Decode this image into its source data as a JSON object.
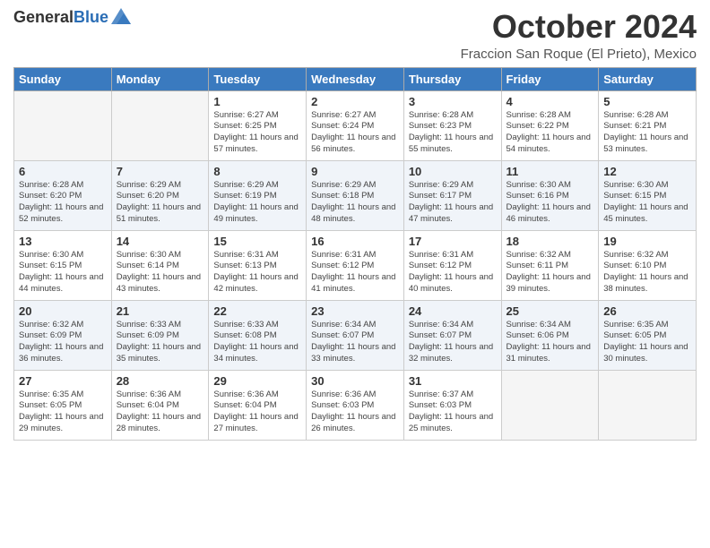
{
  "header": {
    "logo_general": "General",
    "logo_blue": "Blue",
    "month": "October 2024",
    "location": "Fraccion San Roque (El Prieto), Mexico"
  },
  "weekdays": [
    "Sunday",
    "Monday",
    "Tuesday",
    "Wednesday",
    "Thursday",
    "Friday",
    "Saturday"
  ],
  "weeks": [
    [
      {
        "day": "",
        "sunrise": "",
        "sunset": "",
        "daylight": ""
      },
      {
        "day": "",
        "sunrise": "",
        "sunset": "",
        "daylight": ""
      },
      {
        "day": "1",
        "sunrise": "Sunrise: 6:27 AM",
        "sunset": "Sunset: 6:25 PM",
        "daylight": "Daylight: 11 hours and 57 minutes."
      },
      {
        "day": "2",
        "sunrise": "Sunrise: 6:27 AM",
        "sunset": "Sunset: 6:24 PM",
        "daylight": "Daylight: 11 hours and 56 minutes."
      },
      {
        "day": "3",
        "sunrise": "Sunrise: 6:28 AM",
        "sunset": "Sunset: 6:23 PM",
        "daylight": "Daylight: 11 hours and 55 minutes."
      },
      {
        "day": "4",
        "sunrise": "Sunrise: 6:28 AM",
        "sunset": "Sunset: 6:22 PM",
        "daylight": "Daylight: 11 hours and 54 minutes."
      },
      {
        "day": "5",
        "sunrise": "Sunrise: 6:28 AM",
        "sunset": "Sunset: 6:21 PM",
        "daylight": "Daylight: 11 hours and 53 minutes."
      }
    ],
    [
      {
        "day": "6",
        "sunrise": "Sunrise: 6:28 AM",
        "sunset": "Sunset: 6:20 PM",
        "daylight": "Daylight: 11 hours and 52 minutes."
      },
      {
        "day": "7",
        "sunrise": "Sunrise: 6:29 AM",
        "sunset": "Sunset: 6:20 PM",
        "daylight": "Daylight: 11 hours and 51 minutes."
      },
      {
        "day": "8",
        "sunrise": "Sunrise: 6:29 AM",
        "sunset": "Sunset: 6:19 PM",
        "daylight": "Daylight: 11 hours and 49 minutes."
      },
      {
        "day": "9",
        "sunrise": "Sunrise: 6:29 AM",
        "sunset": "Sunset: 6:18 PM",
        "daylight": "Daylight: 11 hours and 48 minutes."
      },
      {
        "day": "10",
        "sunrise": "Sunrise: 6:29 AM",
        "sunset": "Sunset: 6:17 PM",
        "daylight": "Daylight: 11 hours and 47 minutes."
      },
      {
        "day": "11",
        "sunrise": "Sunrise: 6:30 AM",
        "sunset": "Sunset: 6:16 PM",
        "daylight": "Daylight: 11 hours and 46 minutes."
      },
      {
        "day": "12",
        "sunrise": "Sunrise: 6:30 AM",
        "sunset": "Sunset: 6:15 PM",
        "daylight": "Daylight: 11 hours and 45 minutes."
      }
    ],
    [
      {
        "day": "13",
        "sunrise": "Sunrise: 6:30 AM",
        "sunset": "Sunset: 6:15 PM",
        "daylight": "Daylight: 11 hours and 44 minutes."
      },
      {
        "day": "14",
        "sunrise": "Sunrise: 6:30 AM",
        "sunset": "Sunset: 6:14 PM",
        "daylight": "Daylight: 11 hours and 43 minutes."
      },
      {
        "day": "15",
        "sunrise": "Sunrise: 6:31 AM",
        "sunset": "Sunset: 6:13 PM",
        "daylight": "Daylight: 11 hours and 42 minutes."
      },
      {
        "day": "16",
        "sunrise": "Sunrise: 6:31 AM",
        "sunset": "Sunset: 6:12 PM",
        "daylight": "Daylight: 11 hours and 41 minutes."
      },
      {
        "day": "17",
        "sunrise": "Sunrise: 6:31 AM",
        "sunset": "Sunset: 6:12 PM",
        "daylight": "Daylight: 11 hours and 40 minutes."
      },
      {
        "day": "18",
        "sunrise": "Sunrise: 6:32 AM",
        "sunset": "Sunset: 6:11 PM",
        "daylight": "Daylight: 11 hours and 39 minutes."
      },
      {
        "day": "19",
        "sunrise": "Sunrise: 6:32 AM",
        "sunset": "Sunset: 6:10 PM",
        "daylight": "Daylight: 11 hours and 38 minutes."
      }
    ],
    [
      {
        "day": "20",
        "sunrise": "Sunrise: 6:32 AM",
        "sunset": "Sunset: 6:09 PM",
        "daylight": "Daylight: 11 hours and 36 minutes."
      },
      {
        "day": "21",
        "sunrise": "Sunrise: 6:33 AM",
        "sunset": "Sunset: 6:09 PM",
        "daylight": "Daylight: 11 hours and 35 minutes."
      },
      {
        "day": "22",
        "sunrise": "Sunrise: 6:33 AM",
        "sunset": "Sunset: 6:08 PM",
        "daylight": "Daylight: 11 hours and 34 minutes."
      },
      {
        "day": "23",
        "sunrise": "Sunrise: 6:34 AM",
        "sunset": "Sunset: 6:07 PM",
        "daylight": "Daylight: 11 hours and 33 minutes."
      },
      {
        "day": "24",
        "sunrise": "Sunrise: 6:34 AM",
        "sunset": "Sunset: 6:07 PM",
        "daylight": "Daylight: 11 hours and 32 minutes."
      },
      {
        "day": "25",
        "sunrise": "Sunrise: 6:34 AM",
        "sunset": "Sunset: 6:06 PM",
        "daylight": "Daylight: 11 hours and 31 minutes."
      },
      {
        "day": "26",
        "sunrise": "Sunrise: 6:35 AM",
        "sunset": "Sunset: 6:05 PM",
        "daylight": "Daylight: 11 hours and 30 minutes."
      }
    ],
    [
      {
        "day": "27",
        "sunrise": "Sunrise: 6:35 AM",
        "sunset": "Sunset: 6:05 PM",
        "daylight": "Daylight: 11 hours and 29 minutes."
      },
      {
        "day": "28",
        "sunrise": "Sunrise: 6:36 AM",
        "sunset": "Sunset: 6:04 PM",
        "daylight": "Daylight: 11 hours and 28 minutes."
      },
      {
        "day": "29",
        "sunrise": "Sunrise: 6:36 AM",
        "sunset": "Sunset: 6:04 PM",
        "daylight": "Daylight: 11 hours and 27 minutes."
      },
      {
        "day": "30",
        "sunrise": "Sunrise: 6:36 AM",
        "sunset": "Sunset: 6:03 PM",
        "daylight": "Daylight: 11 hours and 26 minutes."
      },
      {
        "day": "31",
        "sunrise": "Sunrise: 6:37 AM",
        "sunset": "Sunset: 6:03 PM",
        "daylight": "Daylight: 11 hours and 25 minutes."
      },
      {
        "day": "",
        "sunrise": "",
        "sunset": "",
        "daylight": ""
      },
      {
        "day": "",
        "sunrise": "",
        "sunset": "",
        "daylight": ""
      }
    ]
  ]
}
